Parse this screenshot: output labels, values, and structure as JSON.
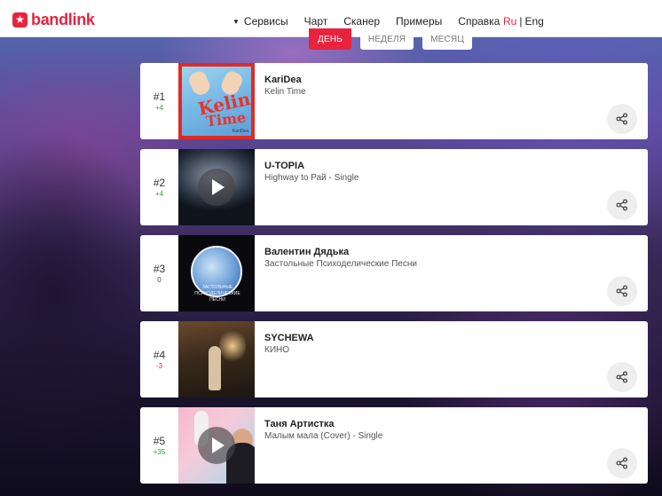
{
  "header": {
    "logo_text": "bandlink",
    "nav": [
      {
        "label": "Сервисы",
        "has_caret": true
      },
      {
        "label": "Чарт"
      },
      {
        "label": "Сканер"
      },
      {
        "label": "Примеры"
      },
      {
        "label": "Справка"
      }
    ],
    "lang": {
      "active": "Ru",
      "separator": "|",
      "other": "Eng"
    }
  },
  "tabs": {
    "day": "ДЕНЬ",
    "week": "НЕДЕЛЯ",
    "month": "МЕСЯЦ",
    "selected": "day"
  },
  "chart": [
    {
      "rank": "#1",
      "delta": "+4",
      "trend": "up",
      "artist": "KariDea",
      "release": "Kelin Time",
      "cover_text": [
        "Kelin",
        "Time",
        "KariDea"
      ],
      "playable": false
    },
    {
      "rank": "#2",
      "delta": "+4",
      "trend": "up",
      "artist": "U-TOPIA",
      "release": "Highway to Рай - Single",
      "playable": true
    },
    {
      "rank": "#3",
      "delta": "0",
      "trend": "zero",
      "artist": "Валентин Дядька",
      "release": "Застольные Психоделические Песни",
      "cover_text": [
        "ЗАСТОЛЬНЫЕ",
        "ПСИХОДЕЛИЧЕСКИЕ",
        "ПЕСНИ"
      ],
      "playable": false
    },
    {
      "rank": "#4",
      "delta": "-3",
      "trend": "down",
      "artist": "SYCHEWA",
      "release": "КИНО",
      "playable": false
    },
    {
      "rank": "#5",
      "delta": "+35",
      "trend": "up",
      "artist": "Таня Артистка",
      "release": "Малым мала (Cover) - Single",
      "playable": true
    }
  ],
  "colors": {
    "accent": "#e8233f",
    "positive": "#2f9e3a",
    "negative": "#e8233f"
  },
  "icons": {
    "share": "share-icon",
    "play": "play-icon",
    "logo": "star-icon"
  }
}
